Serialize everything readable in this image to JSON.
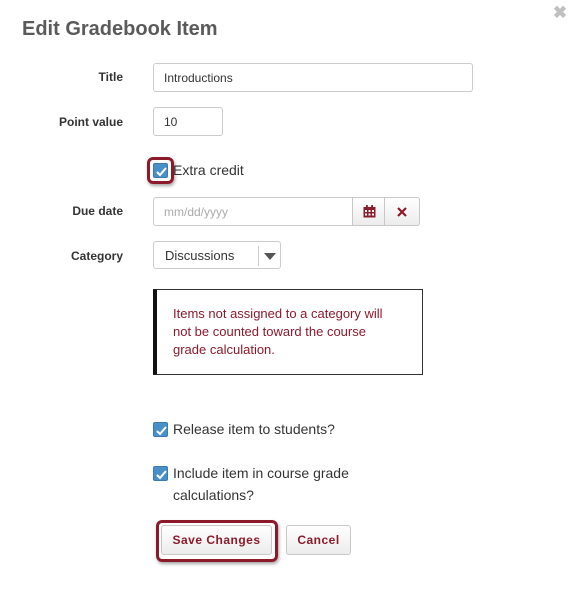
{
  "dialog": {
    "title": "Edit Gradebook Item",
    "close_icon": "close-icon"
  },
  "form": {
    "title_label": "Title",
    "title_value": "Introductions",
    "points_label": "Point value",
    "points_value": "10",
    "extra_credit_label": "Extra credit",
    "extra_credit_checked": true,
    "due_date_label": "Due date",
    "due_date_placeholder": "mm/dd/yyyy",
    "category_label": "Category",
    "category_value": "Discussions",
    "category_notice": "Items not assigned to a category will not be counted toward the course grade calculation.",
    "release_label": "Release item to students?",
    "release_checked": true,
    "include_label": "Include item in course grade calculations?",
    "include_checked": true
  },
  "buttons": {
    "save_label": "Save Changes",
    "cancel_label": "Cancel"
  },
  "colors": {
    "accent": "#8b1a2b",
    "checkbox": "#4a90c8",
    "title_text": "#5a5a5a"
  }
}
